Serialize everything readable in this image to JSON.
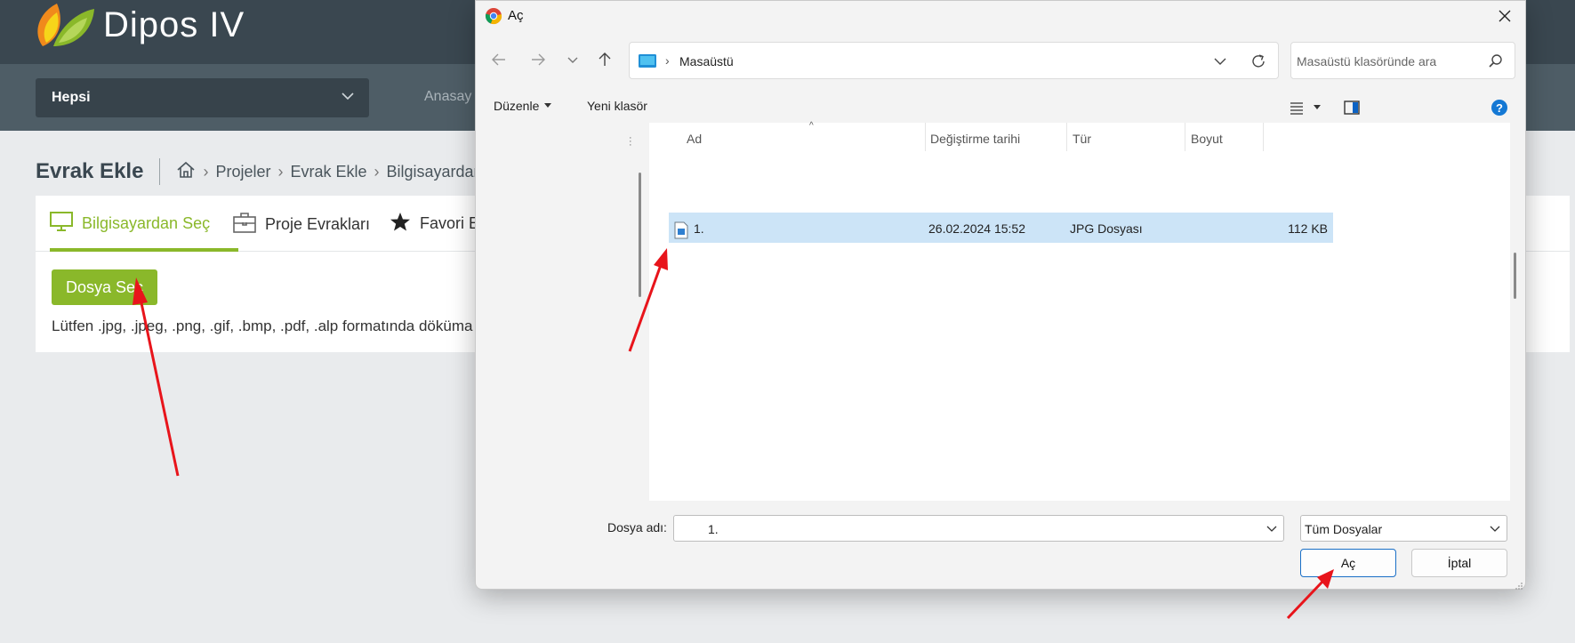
{
  "app": {
    "logo_text": "Dipos IV",
    "filter_select": "Hepsi",
    "nav_link": "Anasay",
    "page_title": "Evrak Ekle",
    "breadcrumb": [
      "Projeler",
      "Evrak Ekle",
      "Bilgisayardan S"
    ],
    "tabs": [
      {
        "label": "Bilgisayardan Seç",
        "icon": "monitor-icon",
        "active": true
      },
      {
        "label": "Proje Evrakları",
        "icon": "briefcase-icon",
        "active": false
      },
      {
        "label": "Favori E",
        "icon": "star-icon",
        "active": false
      }
    ],
    "choose_file_button": "Dosya Seç",
    "hint": "Lütfen .jpg, .jpeg, .png, .gif, .bmp, .pdf, .alp formatında döküma",
    "accent_color": "#8ab82a"
  },
  "dialog": {
    "title": "Aç",
    "address": "Masaüstü",
    "search_placeholder": "Masaüstü klasöründe ara",
    "toolbar": {
      "organize": "Düzenle",
      "new_folder": "Yeni klasör"
    },
    "columns": {
      "name": "Ad",
      "modified": "Değiştirme tarihi",
      "type": "Tür",
      "size": "Boyut"
    },
    "files": [
      {
        "name": "1.",
        "modified": "26.02.2024 15:52",
        "type": "JPG Dosyası",
        "size": "112 KB",
        "selected": true
      }
    ],
    "file_name_label": "Dosya adı:",
    "file_name_value": "1.",
    "file_type": "Tüm Dosyalar",
    "open_button": "Aç",
    "cancel_button": "İptal"
  }
}
